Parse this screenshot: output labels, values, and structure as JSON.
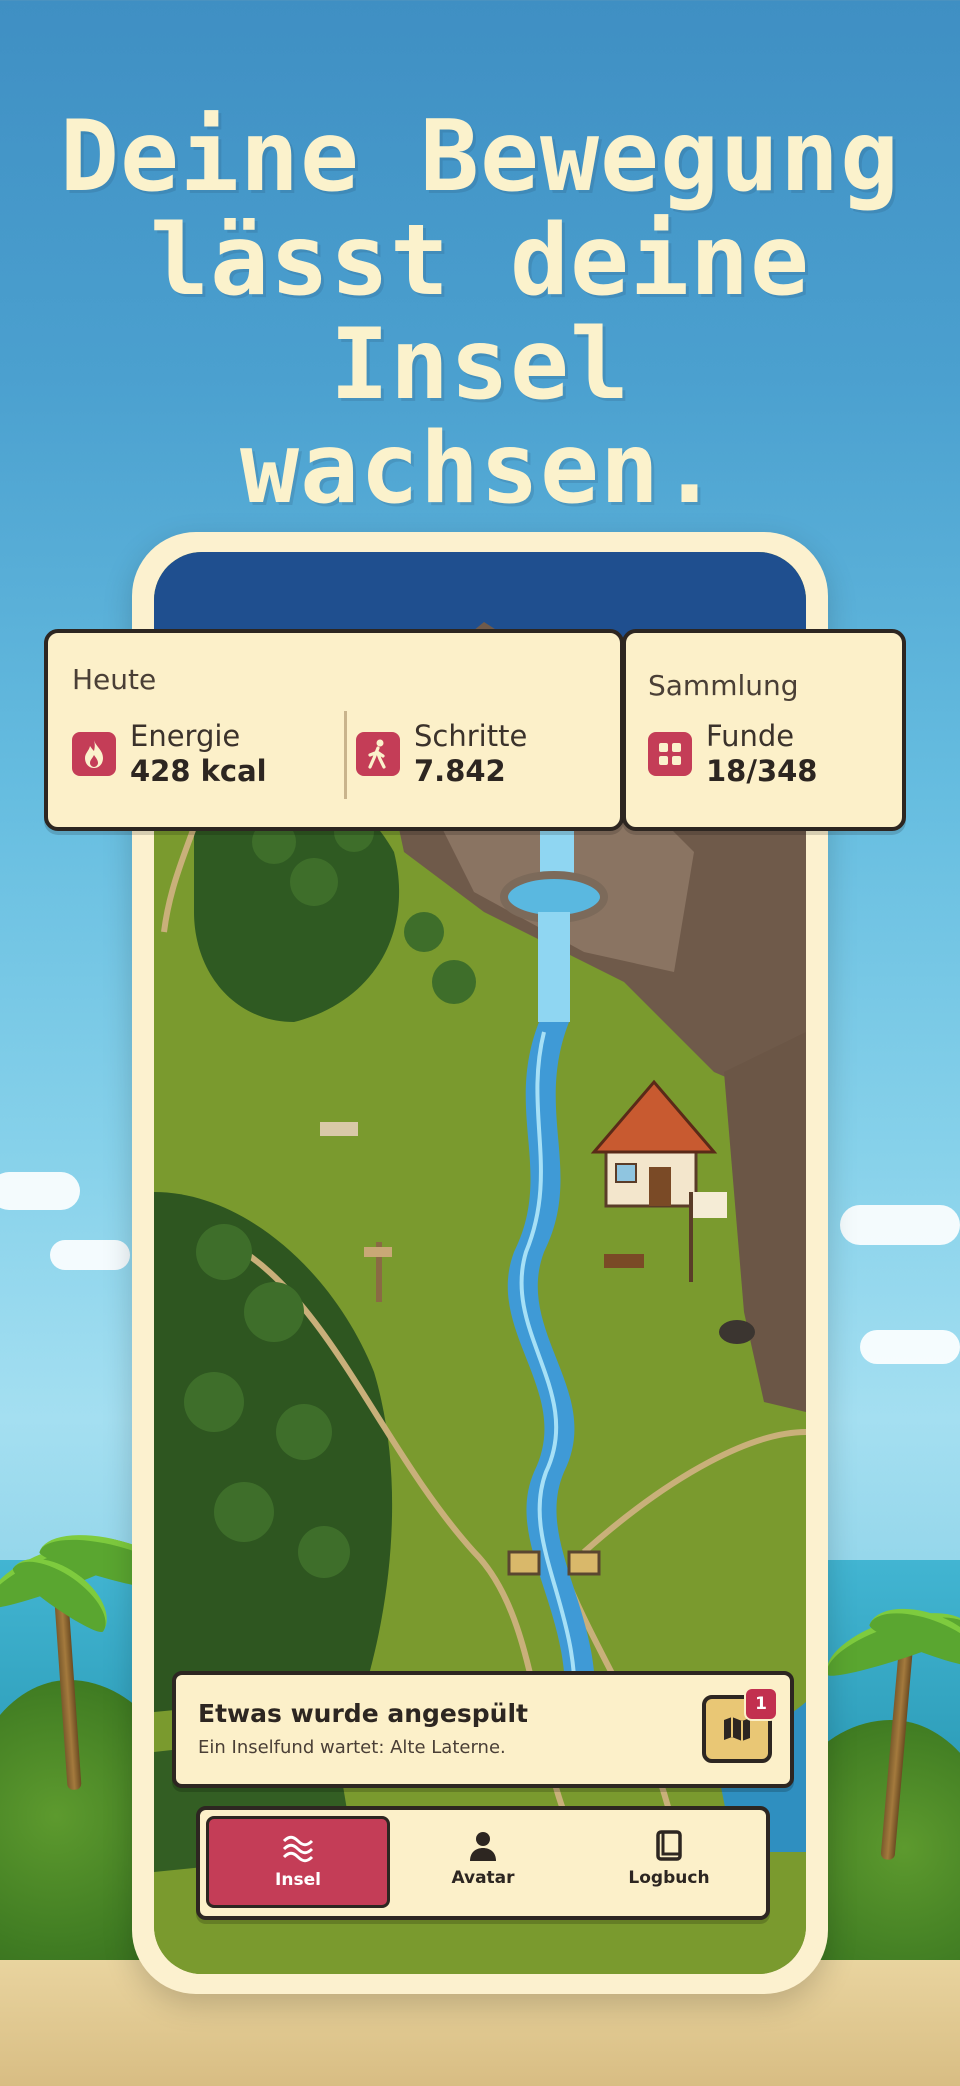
{
  "headline": {
    "line1": "Deine Bewegung",
    "line2": "lässt deine Insel",
    "line3": "wachsen."
  },
  "today_card": {
    "title": "Heute",
    "energy": {
      "label": "Energie",
      "value": "428 kcal",
      "icon": "flame-icon"
    },
    "steps": {
      "label": "Schritte",
      "value": "7.842",
      "icon": "walking-icon"
    }
  },
  "collection_card": {
    "title": "Sammlung",
    "finds": {
      "label": "Funde",
      "value": "18/348",
      "icon": "grid-icon"
    }
  },
  "notification": {
    "title": "Etwas wurde angespült",
    "subtitle": "Ein Inselfund wartet: Alte Laterne.",
    "badge": "1",
    "icon": "map-icon"
  },
  "tabs": [
    {
      "label": "Insel",
      "icon": "waves-icon",
      "active": true
    },
    {
      "label": "Avatar",
      "icon": "person-icon",
      "active": false
    },
    {
      "label": "Logbuch",
      "icon": "book-icon",
      "active": false
    }
  ],
  "colors": {
    "accent": "#c43d57",
    "card_bg": "#fcf0c9",
    "outline": "#2d2621",
    "headline": "#fbf2cc"
  }
}
